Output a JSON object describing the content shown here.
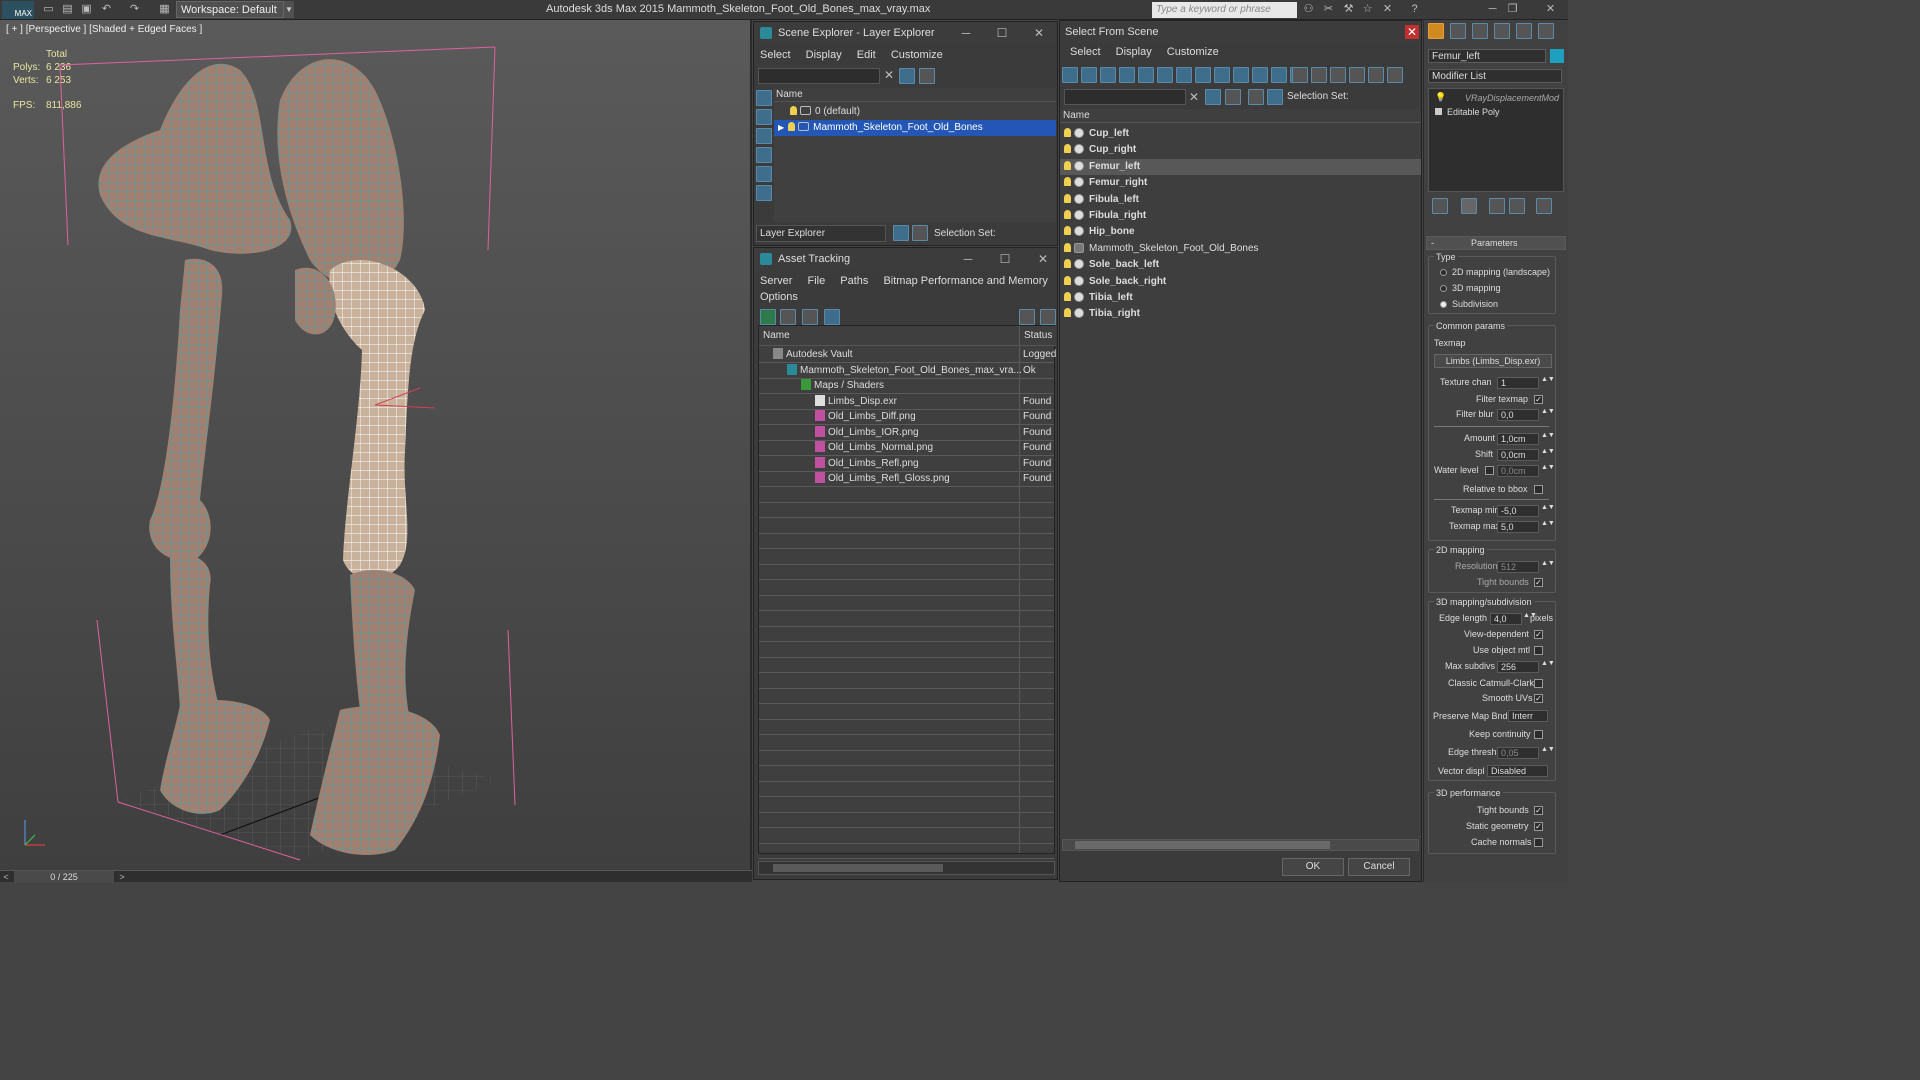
{
  "titlebar": {
    "logo": "MAX",
    "workspace": "Workspace: Default",
    "app_title": "Autodesk 3ds Max  2015     Mammoth_Skeleton_Foot_Old_Bones_max_vray.max",
    "keyword_placeholder": "Type a keyword or phrase"
  },
  "viewport": {
    "label": "[ + ] [Perspective ] [Shaded + Edged Faces ]",
    "stats": {
      "total_label": "Total",
      "polys_label": "Polys:",
      "polys_value": "6 236",
      "verts_label": "Verts:",
      "verts_value": "6 253",
      "fps_label": "FPS:",
      "fps_value": "811,886"
    }
  },
  "timebar": {
    "frame": "0 / 225",
    "prev": "<",
    "next": ">"
  },
  "scene_explorer": {
    "title": "Scene Explorer - Layer Explorer",
    "menu": [
      "Select",
      "Display",
      "Edit",
      "Customize"
    ],
    "col_name": "Name",
    "rows": [
      "0 (default)",
      "Mammoth_Skeleton_Foot_Old_Bones"
    ],
    "footer_dropdown": "Layer Explorer",
    "footer_selection": "Selection Set:"
  },
  "asset_tracking": {
    "title": "Asset Tracking",
    "menu": [
      "Server",
      "File",
      "Paths",
      "Bitmap Performance and Memory",
      "Options"
    ],
    "col_name": "Name",
    "col_status": "Status",
    "rows": [
      {
        "name": "Autodesk Vault",
        "status": "Logged"
      },
      {
        "name": "Mammoth_Skeleton_Foot_Old_Bones_max_vra...",
        "status": "Ok"
      },
      {
        "name": "Maps / Shaders",
        "status": ""
      },
      {
        "name": "Limbs_Disp.exr",
        "status": "Found"
      },
      {
        "name": "Old_Limbs_Diff.png",
        "status": "Found"
      },
      {
        "name": "Old_Limbs_IOR.png",
        "status": "Found"
      },
      {
        "name": "Old_Limbs_Normal.png",
        "status": "Found"
      },
      {
        "name": "Old_Limbs_Refl.png",
        "status": "Found"
      },
      {
        "name": "Old_Limbs_Refl_Gloss.png",
        "status": "Found"
      }
    ]
  },
  "select_from_scene": {
    "title": "Select From Scene",
    "menu": [
      "Select",
      "Display",
      "Customize"
    ],
    "selection_set": "Selection Set:",
    "col_name": "Name",
    "rows": [
      "Cup_left",
      "Cup_right",
      "Femur_left",
      "Femur_right",
      "Fibula_left",
      "Fibula_right",
      "Hip_bone",
      "Mammoth_Skeleton_Foot_Old_Bones",
      "Sole_back_left",
      "Sole_back_right",
      "Tibia_left",
      "Tibia_right"
    ],
    "ok": "OK",
    "cancel": "Cancel"
  },
  "command_panel": {
    "object_name": "Femur_left",
    "modifier_list": "Modifier List",
    "stack": [
      "VRayDisplacementMod",
      "Editable Poly"
    ],
    "parameters": "Parameters",
    "type_label": "Type",
    "type_options": [
      "2D mapping (landscape)",
      "3D mapping",
      "Subdivision"
    ],
    "common_params": "Common params",
    "texmap_label": "Texmap",
    "texmap_value": "Limbs (Limbs_Disp.exr)",
    "texture_chan_label": "Texture chan",
    "texture_chan_value": "1",
    "filter_texmap_label": "Filter texmap",
    "filter_blur_label": "Filter blur",
    "filter_blur_value": "0,0",
    "amount_label": "Amount",
    "amount_value": "1,0cm",
    "shift_label": "Shift",
    "shift_value": "0,0cm",
    "water_level_label": "Water level",
    "water_level_value": "0,0cm",
    "relative_bbox_label": "Relative to bbox",
    "texmap_min_label": "Texmap min",
    "texmap_min_value": "-5,0",
    "texmap_max_label": "Texmap max",
    "texmap_max_value": "5,0",
    "mapping2d_label": "2D mapping",
    "resolution_label": "Resolution",
    "resolution_value": "512",
    "tight_bounds_label": "Tight bounds",
    "mapping3d_label": "3D mapping/subdivision",
    "edge_length_label": "Edge length",
    "edge_length_value": "4,0",
    "pixels_label": "pixels",
    "view_dependent_label": "View-dependent",
    "use_object_mtl_label": "Use object mtl",
    "max_subdivs_label": "Max subdivs",
    "max_subdivs_value": "256",
    "classic_cc_label": "Classic Catmull-Clark",
    "smooth_uvs_label": "Smooth UVs",
    "preserve_map_label": "Preserve Map Bnd",
    "preserve_map_value": "Interr",
    "keep_continuity_label": "Keep continuity",
    "edge_thresh_label": "Edge thresh",
    "edge_thresh_value": "0,05",
    "vector_displ_label": "Vector displ",
    "vector_displ_value": "Disabled",
    "perf3d_label": "3D performance",
    "tight_bounds2_label": "Tight bounds",
    "static_geometry_label": "Static geometry",
    "cache_normals_label": "Cache normals"
  },
  "colors": {
    "selection": "#2457b5",
    "bone": "#a08070",
    "wire": "#2fa8b8",
    "bbox": "#e060a0"
  }
}
